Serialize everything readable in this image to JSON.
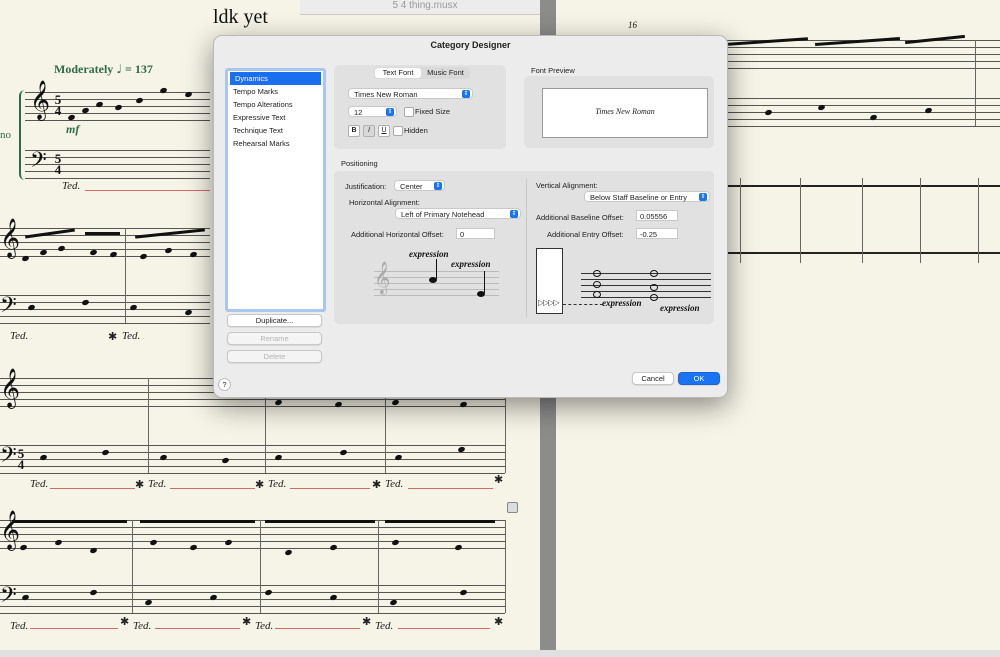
{
  "window": {
    "document_title": "5 4 thing.musx"
  },
  "score": {
    "title_fragment": "ldk yet",
    "tempo": {
      "text": "Moderately",
      "note": "♩",
      "value": "= 137"
    },
    "dynamic": "mf",
    "instrument_fragment": "no",
    "time_signature": {
      "top": "5",
      "bottom": "4"
    },
    "pedal_mark": "Ted.",
    "pedal_release": "✱",
    "measure_number": "16"
  },
  "dialog": {
    "title": "Category Designer",
    "categories": [
      "Dynamics",
      "Tempo Marks",
      "Tempo Alterations",
      "Expressive Text",
      "Technique Text",
      "Rehearsal Marks"
    ],
    "selected_category": "Dynamics",
    "buttons": {
      "duplicate": "Duplicate...",
      "rename": "Rename",
      "delete": "Delete",
      "cancel": "Cancel",
      "ok": "OK",
      "help": "?"
    },
    "font_tabs": [
      "Text Font",
      "Music Font"
    ],
    "active_font_tab": "Text Font",
    "font_name": "Times New Roman",
    "font_size": "12",
    "fixed_size_label": "Fixed Size",
    "style_buttons": [
      "B",
      "I",
      "U"
    ],
    "hidden_label": "Hidden",
    "font_preview_label": "Font Preview",
    "font_preview_text": "Times New Roman",
    "positioning_label": "Positioning",
    "justification_label": "Justification:",
    "justification_value": "Center",
    "horizontal_alignment_label": "Horizontal Alignment:",
    "horizontal_alignment_value": "Left of Primary Notehead",
    "additional_horizontal_offset_label": "Additional Horizontal Offset:",
    "additional_horizontal_offset_value": "0",
    "vertical_alignment_label": "Vertical Alignment:",
    "vertical_alignment_value": "Below Staff Baseline or Entry",
    "additional_baseline_offset_label": "Additional Baseline Offset:",
    "additional_baseline_offset_value": "0.05556",
    "additional_entry_offset_label": "Additional Entry Offset:",
    "additional_entry_offset_value": "-0.25",
    "illustration_word": "expression"
  },
  "colors": {
    "accent": "#1a73f0",
    "tempo_green": "#2f6b4a",
    "pedal_line": "#d26a6a"
  }
}
